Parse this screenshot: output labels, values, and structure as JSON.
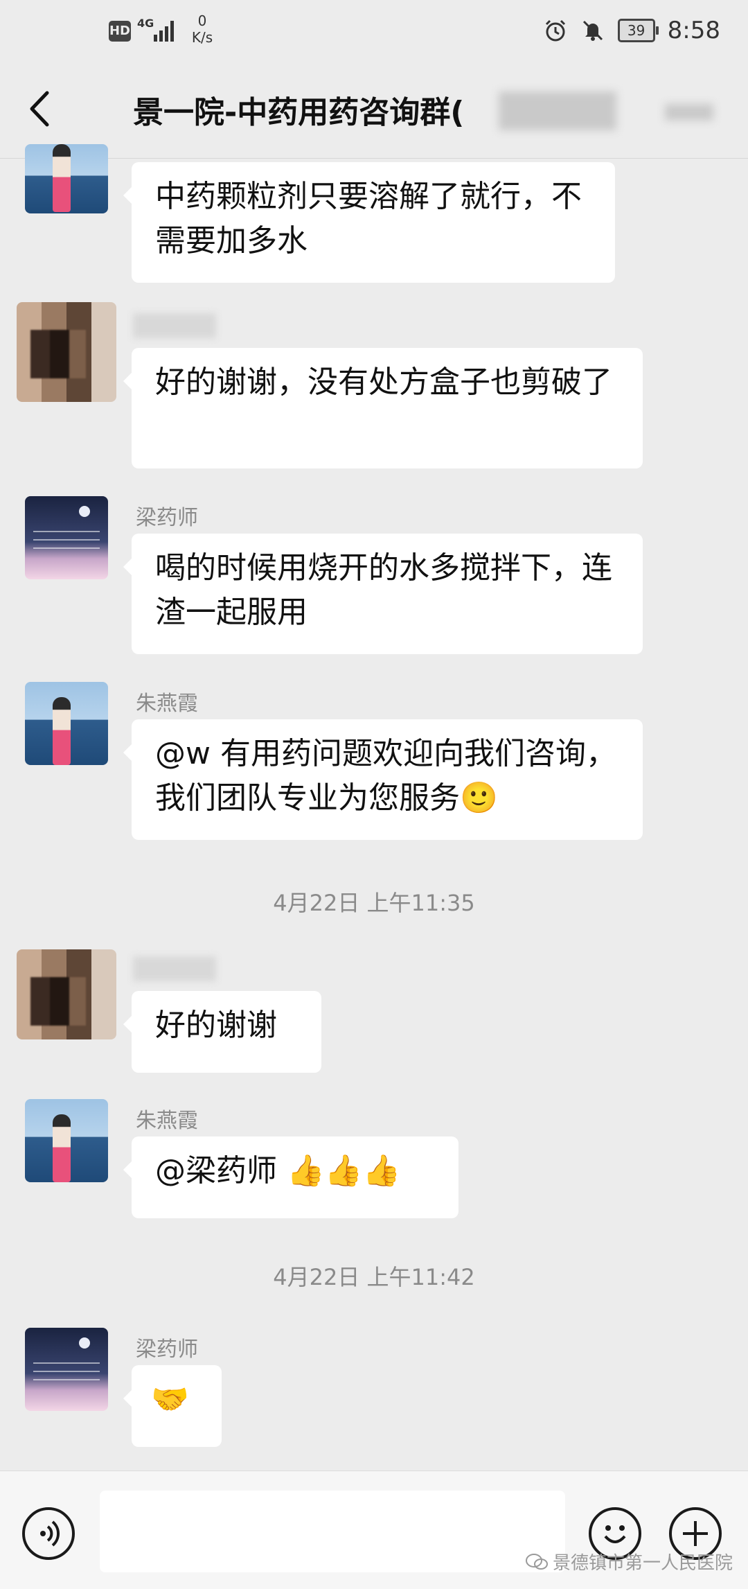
{
  "status_bar": {
    "hd": "HD",
    "network": "4G",
    "speed_value": "0",
    "speed_unit": "K/s",
    "battery": "39",
    "time": "8:58"
  },
  "header": {
    "title": "景一院-中药用药咨询群("
  },
  "messages": [
    {
      "sender": "",
      "text": "中药颗粒剂只要溶解了就行，不需要加多水",
      "avatar": "beach-photo"
    },
    {
      "sender": "",
      "text": "好的谢谢，没有处方盒子也剪破了",
      "avatar": "pixelated-photo"
    },
    {
      "sender": "梁药师",
      "text": "喝的时候用烧开的水多搅拌下，连渣一起服用",
      "avatar": "night-sky-photo"
    },
    {
      "sender": "朱燕霞",
      "text": "@w 有用药问题欢迎向我们咨询，我们团队专业为您服务🙂",
      "avatar": "beach-photo"
    },
    {
      "sender": "",
      "text": "好的谢谢",
      "avatar": "pixelated-photo"
    },
    {
      "sender": "朱燕霞",
      "text": "@梁药师 👍👍👍",
      "avatar": "beach-photo"
    },
    {
      "sender": "梁药师",
      "text": "🤝",
      "avatar": "night-sky-photo"
    }
  ],
  "timestamps": [
    "4月22日 上午11:35",
    "4月22日 上午11:42"
  ],
  "watermark": "景德镇市第一人民医院"
}
